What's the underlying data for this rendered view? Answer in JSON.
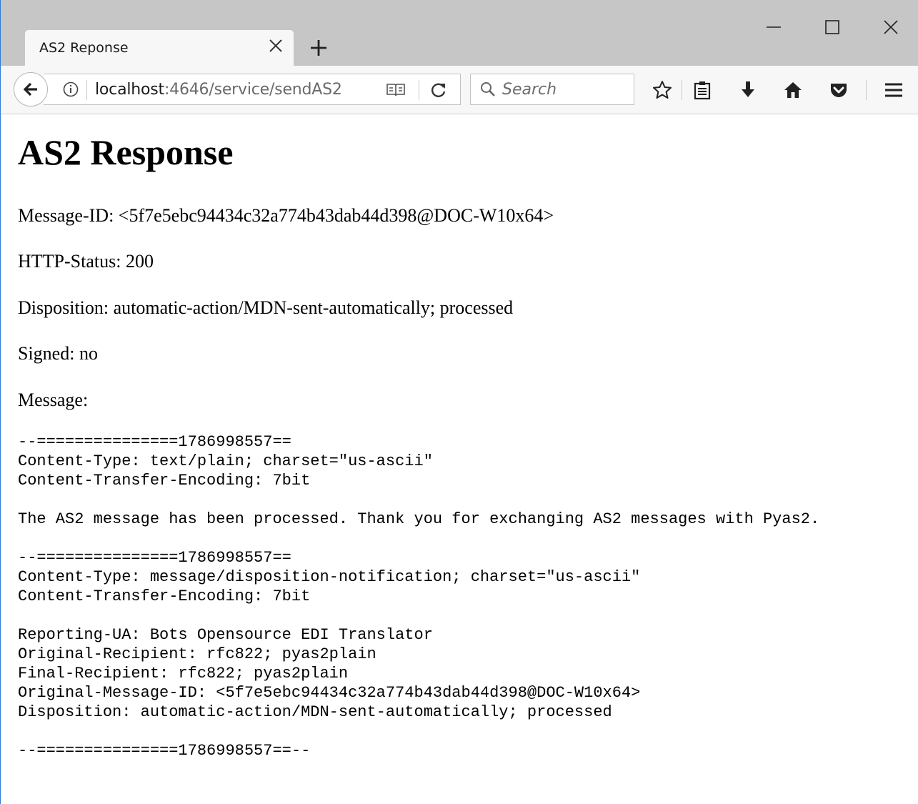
{
  "browser": {
    "tab_title": "AS2 Reponse",
    "url_host": "localhost",
    "url_path": ":4646/service/sendAS2",
    "search_placeholder": "Search",
    "icons": [
      "back-arrow-icon",
      "info-icon",
      "reader-view-icon",
      "reload-icon",
      "search-icon",
      "bookmark-star-icon",
      "reading-list-icon",
      "download-icon",
      "home-icon",
      "pocket-icon",
      "menu-icon",
      "close-icon",
      "new-tab-icon",
      "minimize-icon",
      "maximize-icon",
      "window-close-icon"
    ]
  },
  "page": {
    "heading": "AS2 Response",
    "message_id": "Message-ID: <5f7e5ebc94434c32a774b43dab44d398@DOC-W10x64>",
    "http_status": "HTTP-Status: 200",
    "disposition": "Disposition: automatic-action/MDN-sent-automatically; processed",
    "signed": "Signed: no",
    "message_label": "Message:",
    "message_body": "--===============1786998557==\nContent-Type: text/plain; charset=\"us-ascii\"\nContent-Transfer-Encoding: 7bit\n\nThe AS2 message has been processed. Thank you for exchanging AS2 messages with Pyas2.\n\n--===============1786998557==\nContent-Type: message/disposition-notification; charset=\"us-ascii\"\nContent-Transfer-Encoding: 7bit\n\nReporting-UA: Bots Opensource EDI Translator\nOriginal-Recipient: rfc822; pyas2plain\nFinal-Recipient: rfc822; pyas2plain\nOriginal-Message-ID: <5f7e5ebc94434c32a774b43dab44d398@DOC-W10x64>\nDisposition: automatic-action/MDN-sent-automatically; processed\n\n--===============1786998557==--"
  }
}
